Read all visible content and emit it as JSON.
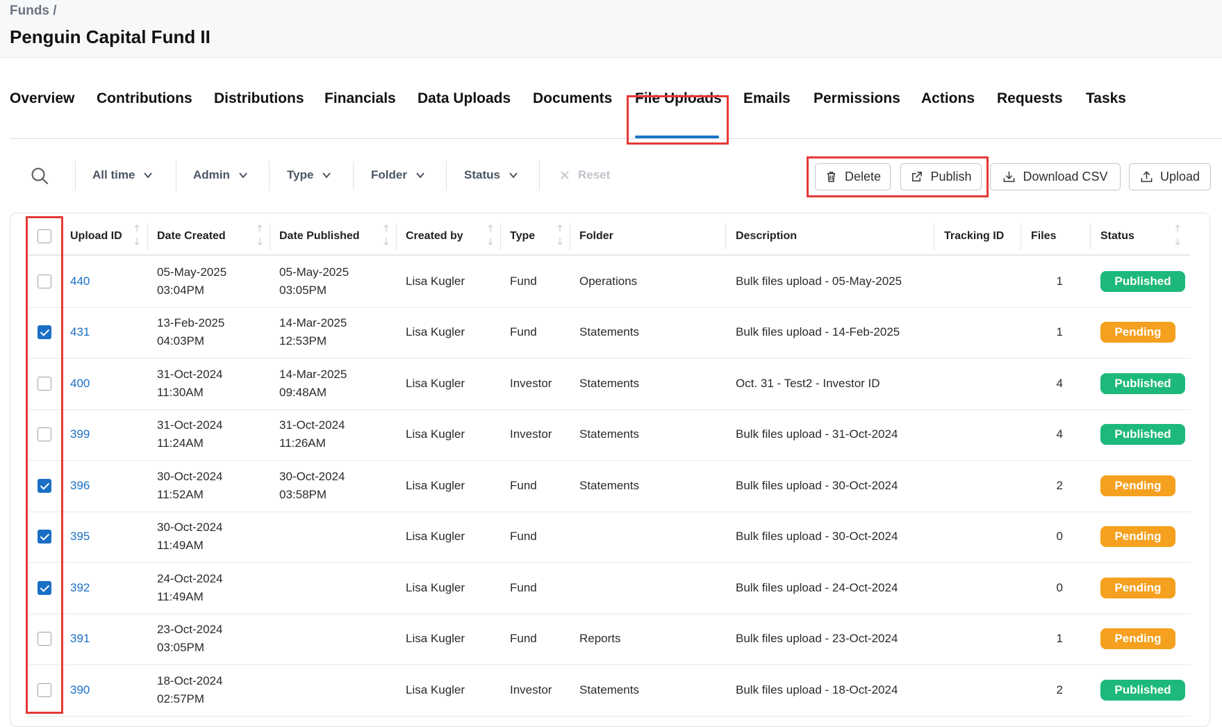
{
  "breadcrumb": "Funds /",
  "title": "Penguin Capital Fund II",
  "tabs": [
    "Overview",
    "Contributions",
    "Distributions",
    "Financials",
    "Data Uploads",
    "Documents",
    "File Uploads",
    "Emails",
    "Permissions",
    "Actions",
    "Requests",
    "Tasks"
  ],
  "active_tab": "File Uploads",
  "filters": {
    "time": "All time",
    "admin": "Admin",
    "type": "Type",
    "folder": "Folder",
    "status": "Status",
    "reset": "Reset"
  },
  "actions": {
    "delete": "Delete",
    "publish": "Publish",
    "download_csv": "Download CSV",
    "upload": "Upload"
  },
  "columns": [
    "Upload ID",
    "Date Created",
    "Date Published",
    "Created by",
    "Type",
    "Folder",
    "Description",
    "Tracking ID",
    "Files",
    "Status"
  ],
  "rows": [
    {
      "checked": false,
      "id": "440",
      "created_date": "05-May-2025",
      "created_time": "03:04PM",
      "published_date": "05-May-2025",
      "published_time": "03:05PM",
      "by": "Lisa Kugler",
      "type": "Fund",
      "folder": "Operations",
      "description": "Bulk files upload - 05-May-2025",
      "tracking": "",
      "files": "1",
      "status": "Published"
    },
    {
      "checked": true,
      "id": "431",
      "created_date": "13-Feb-2025",
      "created_time": "04:03PM",
      "published_date": "14-Mar-2025",
      "published_time": "12:53PM",
      "by": "Lisa Kugler",
      "type": "Fund",
      "folder": "Statements",
      "description": "Bulk files upload - 14-Feb-2025",
      "tracking": "",
      "files": "1",
      "status": "Pending"
    },
    {
      "checked": false,
      "id": "400",
      "created_date": "31-Oct-2024",
      "created_time": "11:30AM",
      "published_date": "14-Mar-2025",
      "published_time": "09:48AM",
      "by": "Lisa Kugler",
      "type": "Investor",
      "folder": "Statements",
      "description": "Oct. 31 - Test2 - Investor ID",
      "tracking": "",
      "files": "4",
      "status": "Published"
    },
    {
      "checked": false,
      "id": "399",
      "created_date": "31-Oct-2024",
      "created_time": "11:24AM",
      "published_date": "31-Oct-2024",
      "published_time": "11:26AM",
      "by": "Lisa Kugler",
      "type": "Investor",
      "folder": "Statements",
      "description": "Bulk files upload - 31-Oct-2024",
      "tracking": "",
      "files": "4",
      "status": "Published"
    },
    {
      "checked": true,
      "id": "396",
      "created_date": "30-Oct-2024",
      "created_time": "11:52AM",
      "published_date": "30-Oct-2024",
      "published_time": "03:58PM",
      "by": "Lisa Kugler",
      "type": "Fund",
      "folder": "Statements",
      "description": "Bulk files upload - 30-Oct-2024",
      "tracking": "",
      "files": "2",
      "status": "Pending"
    },
    {
      "checked": true,
      "id": "395",
      "created_date": "30-Oct-2024",
      "created_time": "11:49AM",
      "published_date": "",
      "published_time": "",
      "by": "Lisa Kugler",
      "type": "Fund",
      "folder": "",
      "description": "Bulk files upload - 30-Oct-2024",
      "tracking": "",
      "files": "0",
      "status": "Pending"
    },
    {
      "checked": true,
      "id": "392",
      "created_date": "24-Oct-2024",
      "created_time": "11:49AM",
      "published_date": "",
      "published_time": "",
      "by": "Lisa Kugler",
      "type": "Fund",
      "folder": "",
      "description": "Bulk files upload - 24-Oct-2024",
      "tracking": "",
      "files": "0",
      "status": "Pending"
    },
    {
      "checked": false,
      "id": "391",
      "created_date": "23-Oct-2024",
      "created_time": "03:05PM",
      "published_date": "",
      "published_time": "",
      "by": "Lisa Kugler",
      "type": "Fund",
      "folder": "Reports",
      "description": "Bulk files upload - 23-Oct-2024",
      "tracking": "",
      "files": "1",
      "status": "Pending"
    },
    {
      "checked": false,
      "id": "390",
      "created_date": "18-Oct-2024",
      "created_time": "02:57PM",
      "published_date": "",
      "published_time": "",
      "by": "Lisa Kugler",
      "type": "Investor",
      "folder": "Statements",
      "description": "Bulk files upload - 18-Oct-2024",
      "tracking": "",
      "files": "2",
      "status": "Published"
    }
  ],
  "colors": {
    "link": "#1a6fc4",
    "published": "#1db97a",
    "pending": "#f5a01e",
    "highlight": "#e53935",
    "tab_underline": "#1a73c8"
  }
}
